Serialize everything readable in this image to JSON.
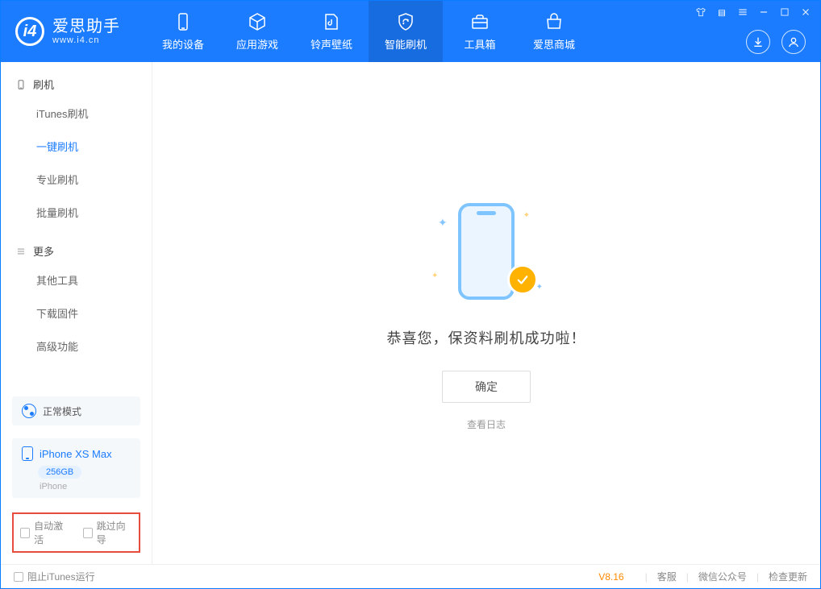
{
  "app": {
    "title": "爱思助手",
    "subtitle": "www.i4.cn"
  },
  "nav": {
    "items": [
      {
        "label": "我的设备"
      },
      {
        "label": "应用游戏"
      },
      {
        "label": "铃声壁纸"
      },
      {
        "label": "智能刷机"
      },
      {
        "label": "工具箱"
      },
      {
        "label": "爱思商城"
      }
    ]
  },
  "sidebar": {
    "section1": {
      "title": "刷机",
      "items": [
        "iTunes刷机",
        "一键刷机",
        "专业刷机",
        "批量刷机"
      ]
    },
    "section2": {
      "title": "更多",
      "items": [
        "其他工具",
        "下载固件",
        "高级功能"
      ]
    },
    "mode": "正常模式",
    "device": {
      "name": "iPhone XS Max",
      "storage": "256GB",
      "type": "iPhone"
    },
    "checkboxes": {
      "auto_activate": "自动激活",
      "skip_guide": "跳过向导"
    }
  },
  "main": {
    "success_message": "恭喜您，保资料刷机成功啦！",
    "ok_button": "确定",
    "view_log": "查看日志"
  },
  "statusbar": {
    "block_itunes": "阻止iTunes运行",
    "version": "V8.16",
    "links": [
      "客服",
      "微信公众号",
      "检查更新"
    ]
  }
}
